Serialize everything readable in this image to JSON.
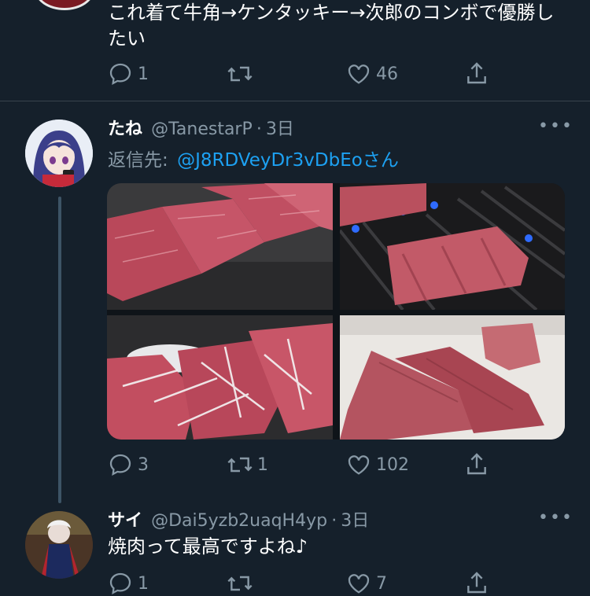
{
  "tweet_prev": {
    "text_line1": "これ着て牛角→ケンタッキー→次郎のコンボで優勝し",
    "text_line2": "たい",
    "reply_count": "1",
    "retweet_count": "",
    "like_count": "46"
  },
  "tweet_main": {
    "display_name": "たね",
    "handle": "@TanestarP",
    "separator": "·",
    "time": "3日",
    "reply_to_label": "返信先:",
    "reply_to_handle": "@J8RDVeyDr3vDbEo",
    "reply_to_suffix": "さん",
    "reply_count": "3",
    "retweet_count": "1",
    "like_count": "102",
    "photos": [
      "grilled-beef-slices-on-plate",
      "beef-on-grill",
      "beef-with-onion",
      "thick-cut-beef-tongue"
    ]
  },
  "tweet_next": {
    "display_name": "サイ",
    "handle": "@Dai5yzb2uaqH4yp",
    "separator": "·",
    "time": "3日",
    "text": "焼肉って最高ですよね♪",
    "reply_count": "1",
    "like_count": "7"
  },
  "icons": {
    "reply": "speech-bubble-icon",
    "retweet": "retweet-arrows-icon",
    "like": "heart-icon",
    "share": "share-upload-icon",
    "more": "more-dots-icon"
  },
  "colors": {
    "background": "#15202b",
    "muted": "#8899a6",
    "link": "#1da1f2",
    "divider": "#38444d"
  }
}
